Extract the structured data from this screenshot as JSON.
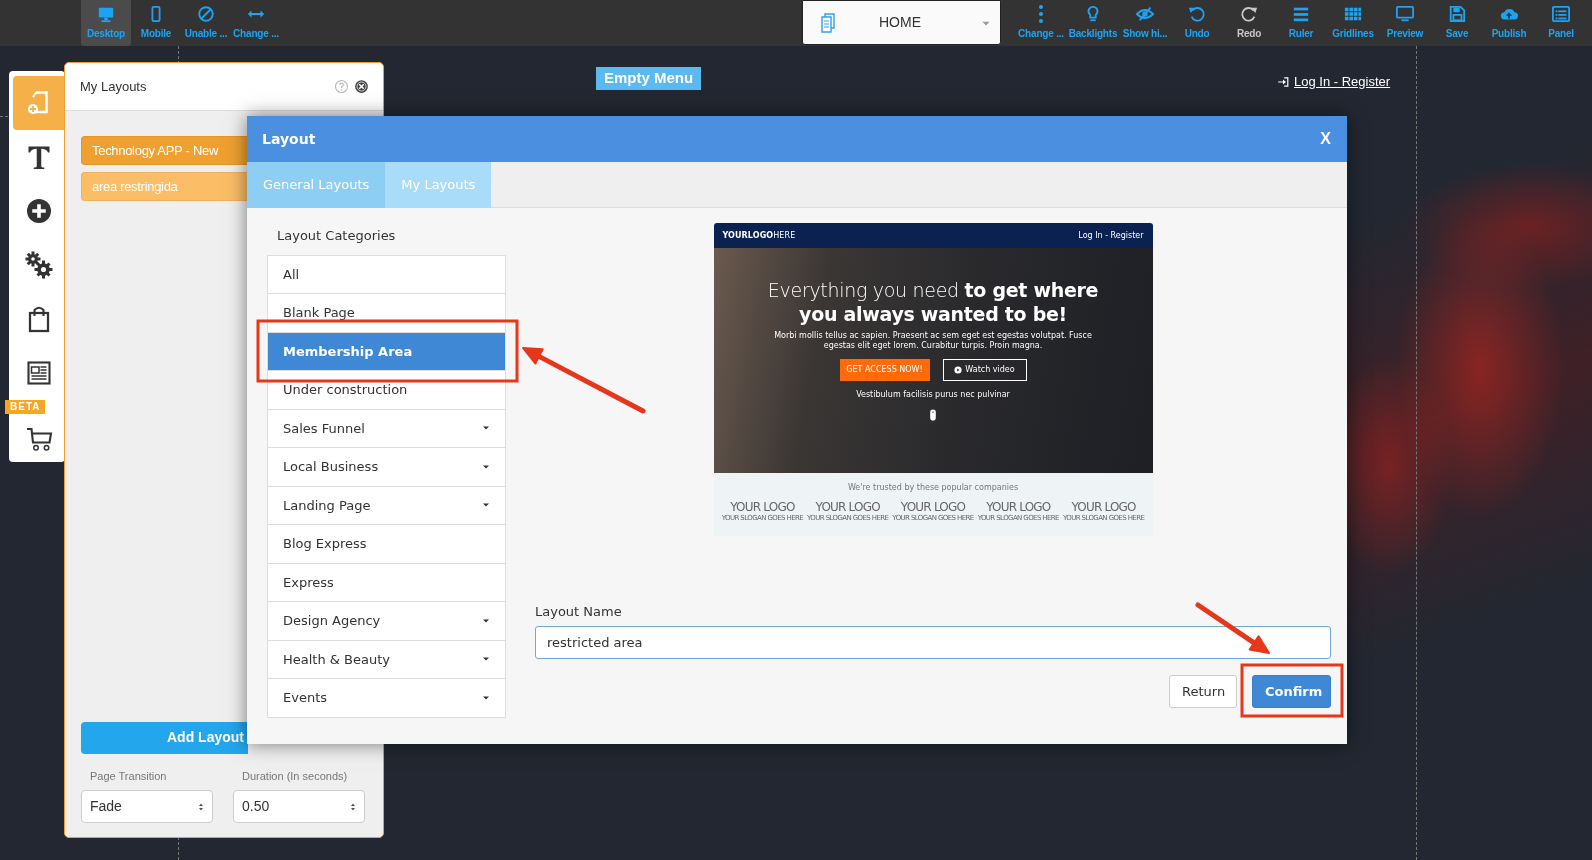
{
  "toolbar": {
    "left_items": [
      {
        "label": "Desktop",
        "selected": true
      },
      {
        "label": "Mobile",
        "selected": false
      },
      {
        "label": "Unable ...",
        "selected": false
      },
      {
        "label": "Change ...",
        "selected": false
      }
    ],
    "page_select": {
      "value": "HOME"
    },
    "right_items": [
      {
        "label": "Change ...",
        "disabled": false
      },
      {
        "label": "Backlights",
        "disabled": false
      },
      {
        "label": "Show hi...",
        "disabled": false
      },
      {
        "label": "Undo",
        "disabled": false
      },
      {
        "label": "Redo",
        "disabled": true
      },
      {
        "label": "Ruler",
        "disabled": false
      },
      {
        "label": "Gridlines",
        "disabled": false
      },
      {
        "label": "Preview",
        "disabled": false
      },
      {
        "label": "Save",
        "disabled": false
      },
      {
        "label": "Publish",
        "disabled": false
      },
      {
        "label": "Panel",
        "disabled": false
      }
    ]
  },
  "sidebar": {
    "items": [
      {
        "selected": true
      },
      {
        "selected": false
      },
      {
        "selected": false
      },
      {
        "selected": false
      },
      {
        "selected": false
      },
      {
        "selected": false
      },
      {
        "selected": false,
        "badge": "BETA"
      }
    ]
  },
  "canvas": {
    "menu_button": "Empty Menu",
    "login_link": "Log In - Register"
  },
  "layouts_panel": {
    "title": "My Layouts",
    "items": [
      {
        "label": "Technology APP - New",
        "selected": true
      },
      {
        "label": "area restringida",
        "selected": false
      }
    ],
    "add_button": "Add Layout",
    "page_transition": {
      "label": "Page Transition",
      "value": "Fade"
    },
    "duration": {
      "label": "Duration (In seconds)",
      "value": "0.50"
    }
  },
  "modal": {
    "title": "Layout",
    "close": "X",
    "tabs": [
      {
        "label": "General Layouts",
        "selected": true
      },
      {
        "label": "My Layouts",
        "selected": false
      }
    ],
    "categories_title": "Layout Categories",
    "categories": [
      {
        "label": "All",
        "selected": false,
        "has_submenu": false
      },
      {
        "label": "Blank Page",
        "selected": false,
        "has_submenu": false
      },
      {
        "label": "Membership Area",
        "selected": true,
        "has_submenu": false
      },
      {
        "label": "Under construction",
        "selected": false,
        "has_submenu": false
      },
      {
        "label": "Sales Funnel",
        "selected": false,
        "has_submenu": true
      },
      {
        "label": "Local Business",
        "selected": false,
        "has_submenu": true
      },
      {
        "label": "Landing Page",
        "selected": false,
        "has_submenu": true
      },
      {
        "label": "Blog Express",
        "selected": false,
        "has_submenu": false
      },
      {
        "label": "Express",
        "selected": false,
        "has_submenu": false
      },
      {
        "label": "Design Agency",
        "selected": false,
        "has_submenu": true
      },
      {
        "label": "Health & Beauty",
        "selected": false,
        "has_submenu": true
      },
      {
        "label": "Events",
        "selected": false,
        "has_submenu": true
      }
    ],
    "preview": {
      "logo": "**YOURLOGO**HERE",
      "login": "Log In - Register",
      "headline": "Everything you need **to get where you always wanted to be!**",
      "paragraph": "Morbi mollis tellus ac sapien. Praesent ac sem eget est egestas volutpat. Fusce egestas elit eget lorem. Curabitur turpis. Proin magna.",
      "cta": "GET ACCESS NOW!",
      "video_button": "Watch video",
      "note": "Vestibulum facilisis purus nec pulvinar",
      "trusted": "We're trusted by these popular companies",
      "logos": [
        {
          "name": "YOUR LOGO",
          "slogan": "YOUR SLOGAN GOES HERE"
        },
        {
          "name": "YOUR LOGO",
          "slogan": "YOUR SLOGAN GOES HERE"
        },
        {
          "name": "YOUR LOGO",
          "slogan": "YOUR SLOGAN GOES HERE"
        },
        {
          "name": "YOUR LOGO",
          "slogan": "YOUR SLOGAN GOES HERE"
        },
        {
          "name": "YOUR LOGO",
          "slogan": "YOUR SLOGAN GOES HERE"
        }
      ]
    },
    "name_label": "Layout Name",
    "name_value": "restricted area",
    "buttons": [
      {
        "label": "Return",
        "kind": "secondary"
      },
      {
        "label": "Confirm",
        "kind": "primary"
      }
    ]
  }
}
